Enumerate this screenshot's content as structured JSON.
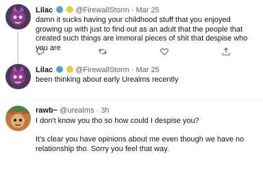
{
  "tweets": [
    {
      "name": "Lilac",
      "handle_date": "@FirewallStorm · Mar 25",
      "text": "damn it sucks having your childhood stuff that you enjoyed growing up with just to find out as an adult that the people that created such things are immoral pieces of shit that despise who you are",
      "badges": [
        "#5b9bd5",
        "#f2c744"
      ],
      "actions": [
        "reply-icon",
        "retweet-icon",
        "like-icon",
        "share-icon"
      ]
    },
    {
      "name": "Lilac",
      "handle_date": "@FirewallStorm · Mar 25",
      "text": "been thinking about early Urealms recently",
      "badges": [
        "#5b9bd5",
        "#f2c744"
      ]
    },
    {
      "name": "rawb~",
      "handle_date": "@urealms · 3h",
      "text": "I don't know you tho so how could I despise you?\n\nIt's clear you have opinions about me even though we have no relationship tho. Sorry you feel that way."
    }
  ],
  "colors": {
    "name": "#0f1419",
    "muted": "#536471",
    "line": "#cfd9de",
    "badge_blue": "#5b9bd5",
    "badge_yellow": "#f2c744"
  }
}
